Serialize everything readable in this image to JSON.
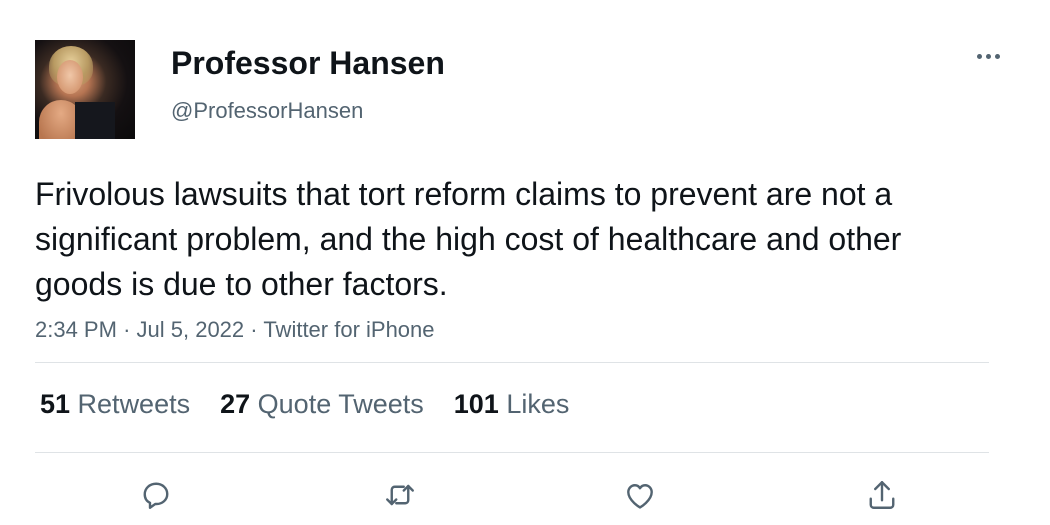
{
  "user": {
    "display_name": "Professor Hansen",
    "handle": "@ProfessorHansen"
  },
  "tweet": {
    "text": "Frivolous lawsuits that tort reform claims to prevent are not a significant problem, and the high cost of healthcare and other goods is due to other factors.",
    "time": "2:34 PM",
    "date": "Jul 5, 2022",
    "source": "Twitter for iPhone",
    "separator": "·"
  },
  "stats": {
    "retweets": {
      "count": "51",
      "label": "Retweets"
    },
    "quote_tweets": {
      "count": "27",
      "label": "Quote Tweets"
    },
    "likes": {
      "count": "101",
      "label": "Likes"
    }
  },
  "icons": {
    "more": "more-horizontal-icon",
    "reply": "reply-icon",
    "retweet": "retweet-icon",
    "like": "heart-icon",
    "share": "share-icon"
  },
  "colors": {
    "text_primary": "#0f1419",
    "text_secondary": "#536471",
    "divider": "#dfe3e6"
  }
}
